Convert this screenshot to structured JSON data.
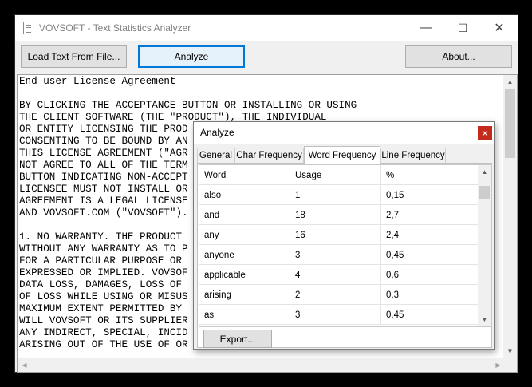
{
  "window": {
    "title": "VOVSOFT - Text Statistics Analyzer",
    "minimize_glyph": "—",
    "maximize_glyph": "☐",
    "close_glyph": "✕"
  },
  "toolbar": {
    "load_label": "Load Text From File...",
    "analyze_label": "Analyze",
    "about_label": "About..."
  },
  "document": {
    "lines": [
      "End-user License Agreement",
      "",
      "BY CLICKING THE ACCEPTANCE BUTTON OR INSTALLING OR USING",
      "THE CLIENT SOFTWARE (THE \"PRODUCT\"), THE INDIVIDUAL",
      "OR ENTITY LICENSING THE PROD",
      "CONSENTING TO BE BOUND BY AN",
      "THIS LICENSE AGREEMENT (\"AGR",
      "NOT AGREE TO ALL OF THE TERM",
      "BUTTON INDICATING NON-ACCEPT",
      "LICENSEE MUST NOT INSTALL OR",
      "AGREEMENT IS A LEGAL LICENSE",
      "AND VOVSOFT.COM (\"VOVSOFT\").",
      "",
      "1. NO WARRANTY. THE PRODUCT",
      "WITHOUT ANY WARRANTY AS TO P",
      "FOR A PARTICULAR PURPOSE OR",
      "EXPRESSED OR IMPLIED. VOVSOF",
      "DATA LOSS, DAMAGES, LOSS OF",
      "OF LOSS WHILE USING OR MISUS",
      "MAXIMUM EXTENT PERMITTED BY",
      "WILL VOVSOFT OR ITS SUPPLIER",
      "ANY INDIRECT, SPECIAL, INCID",
      "ARISING OUT OF THE USE OF OR"
    ]
  },
  "dialog": {
    "title": "Analyze",
    "close_glyph": "✕",
    "tabs": [
      {
        "label": "General"
      },
      {
        "label": "Char Frequency"
      },
      {
        "label": "Word Frequency"
      },
      {
        "label": "Line Frequency"
      }
    ],
    "active_tab": "Word Frequency",
    "grid": {
      "columns": [
        "Word",
        "Usage",
        "%"
      ],
      "rows": [
        {
          "word": "also",
          "usage": "1",
          "pct": "0,15"
        },
        {
          "word": "and",
          "usage": "18",
          "pct": "2,7"
        },
        {
          "word": "any",
          "usage": "16",
          "pct": "2,4"
        },
        {
          "word": "anyone",
          "usage": "3",
          "pct": "0,45"
        },
        {
          "word": "applicable",
          "usage": "4",
          "pct": "0,6"
        },
        {
          "word": "arising",
          "usage": "2",
          "pct": "0,3"
        },
        {
          "word": "as",
          "usage": "3",
          "pct": "0,45"
        }
      ]
    },
    "export_label": "Export..."
  },
  "icons": {
    "scroll_up": "▲",
    "scroll_down": "▼",
    "scroll_left": "◀",
    "scroll_right": "▶"
  }
}
